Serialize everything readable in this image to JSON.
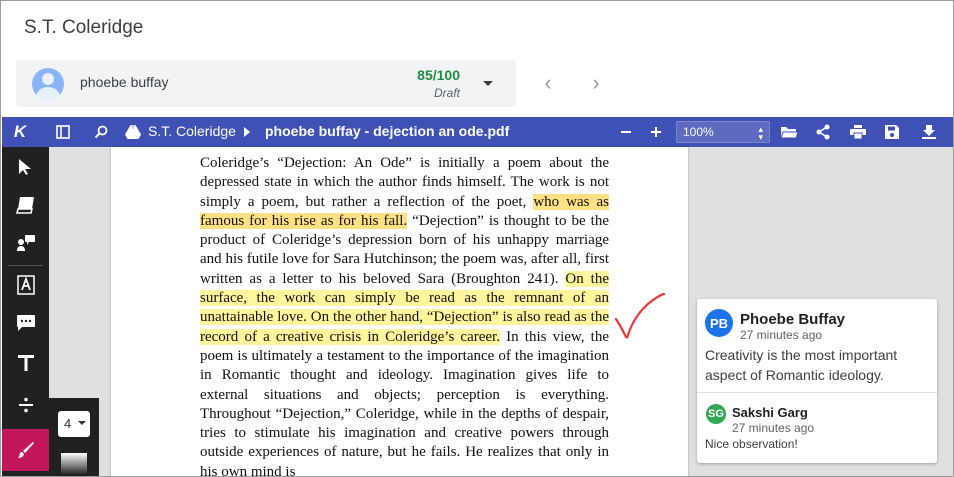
{
  "app": {
    "title": "S.T. Coleridge"
  },
  "student": {
    "name": "phoebe buffay",
    "grade": "85/100",
    "status": "Draft"
  },
  "nav": {
    "prev": "‹",
    "next": "›"
  },
  "toolbar": {
    "logo": "K",
    "breadcrumb": "S.T. Coleridge",
    "file_name": "phoebe buffay - dejection an ode.pdf",
    "zoom": "100%"
  },
  "stroke_size": {
    "value": "4"
  },
  "document": {
    "segments": [
      {
        "text": "Coleridge’s “Dejection: An Ode” is initially a poem about the depressed state in which the author finds himself. The work is not simply a poem, but rather a reflection of the poet, ",
        "hl": ""
      },
      {
        "text": "who was as famous for his rise as for his fall.",
        "hl": "hl1"
      },
      {
        "text": " “Dejection” is thought to be the product of Coleridge’s depression born of his unhappy marriage and his futile love for Sara Hutchinson; the poem was, after all, first written as a letter to his beloved Sara (Broughton 241). ",
        "hl": ""
      },
      {
        "text": "On the surface, the work can simply be read as the remnant of an unattainable love. On the other hand, “Dejection” is also read as the record of a creative crisis in Coleridge’s career.",
        "hl": "hl2"
      },
      {
        "text": " In this view, the poem is ultimately a testament to the importance of the imagination in Romantic thought and ideology. Imagination gives life to external situations and objects; perception is everything. Throughout “Dejection,” Coleridge, while in the depths of despair, tries to stimulate his imagination and creative powers through outside experiences of nature, but he fails. He realizes that only in his own mind is",
        "hl": ""
      }
    ]
  },
  "comments": [
    {
      "initials": "PB",
      "author": "Phoebe Buffay",
      "time": "27 minutes ago",
      "text": "Creativity is the most important aspect of Romantic ideology.",
      "color": "#1a73e8"
    },
    {
      "initials": "SG",
      "author": "Sakshi Garg",
      "time": "27 minutes ago",
      "text": "Nice observation!",
      "color": "#34a853"
    }
  ],
  "colors": {
    "toolbar": "#3f51b5",
    "sidebar": "#212121",
    "active_tool": "#c2185b",
    "annotation": "#e53935",
    "highlight_orange": "#ffe082",
    "highlight_yellow": "#fff59d"
  }
}
